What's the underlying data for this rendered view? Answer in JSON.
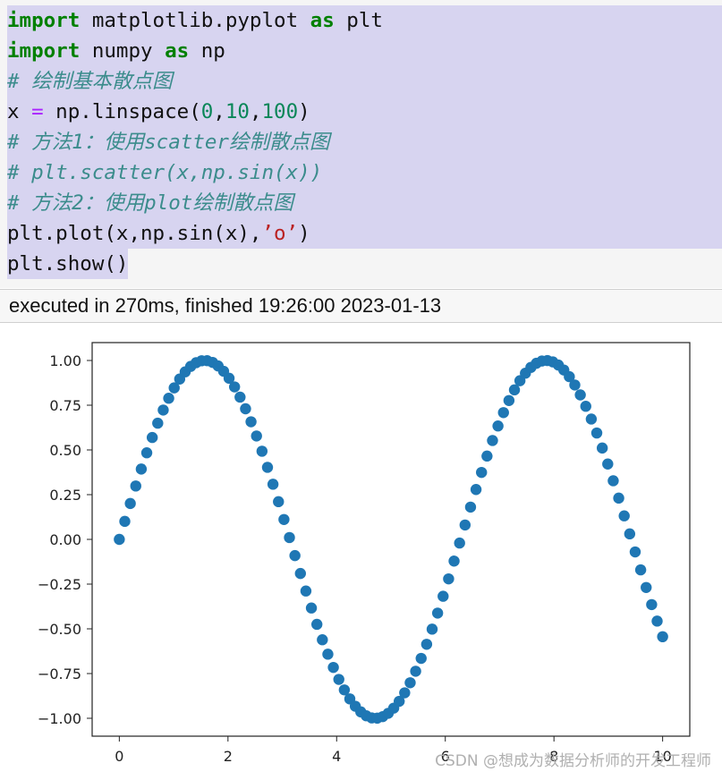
{
  "code": {
    "line1": {
      "kw1": "import",
      "t1": " matplotlib.pyplot ",
      "kw2": "as",
      "t2": " plt"
    },
    "line2": {
      "kw1": "import",
      "t1": " numpy ",
      "kw2": "as",
      "t2": " np"
    },
    "line3": {
      "comment": "# 绘制基本散点图"
    },
    "line4": {
      "t1": "x ",
      "op": "=",
      "t2": " np.linspace(",
      "n1": "0",
      ",1": ",",
      "n2": "10",
      ",2": ",",
      "n3": "100",
      "t3": ")"
    },
    "line5": {
      "comment": "# 方法1：使用scatter绘制散点图"
    },
    "line6": {
      "comment": "# plt.scatter(x,np.sin(x))"
    },
    "line7": {
      "comment": "# 方法2：使用plot绘制散点图"
    },
    "line8": {
      "t1": "plt.plot(x,np.sin(x),",
      "str": "’o’",
      "t2": ")"
    },
    "line9": {
      "t1": "plt.show()"
    }
  },
  "execution": {
    "status": "executed in 270ms, finished 19:26:00 2023-01-13"
  },
  "chart_data": {
    "type": "scatter",
    "x_range": [
      0,
      10
    ],
    "num_points": 100,
    "function": "sin(x)",
    "xlim": [
      -0.5,
      10.5
    ],
    "ylim": [
      -1.1,
      1.1
    ],
    "xticks": [
      0,
      2,
      4,
      6,
      8,
      10
    ],
    "yticks": [
      1.0,
      0.75,
      0.5,
      0.25,
      0.0,
      -0.25,
      -0.5,
      -0.75,
      -1.0
    ],
    "ytick_labels": [
      "1.00",
      "0.75",
      "0.50",
      "0.25",
      "0.00",
      "−0.25",
      "−0.50",
      "−0.75",
      "−1.00"
    ],
    "marker_color": "#1f77b4"
  },
  "watermark": "CSDN @想成为数据分析师的开发工程师"
}
